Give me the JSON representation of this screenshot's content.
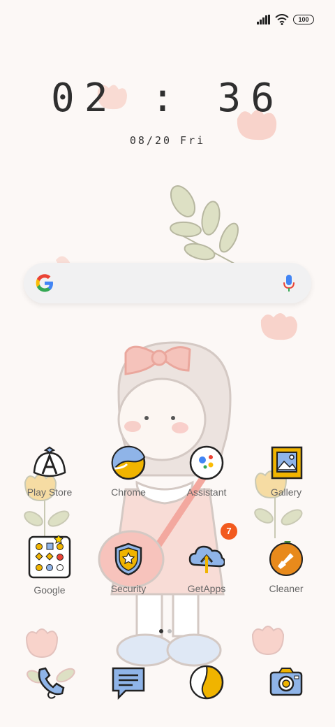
{
  "status_bar": {
    "battery": "100",
    "icons": [
      "signal-icon",
      "wifi-icon",
      "battery-icon"
    ]
  },
  "clock": {
    "time": "02 : 36",
    "date": "08/20 Fri"
  },
  "search": {
    "logo": "google-g-icon",
    "mic": "mic-icon"
  },
  "apps": {
    "row1": [
      {
        "label": "Play Store",
        "icon": "play-store-icon"
      },
      {
        "label": "Chrome",
        "icon": "chrome-icon"
      },
      {
        "label": "Assistant",
        "icon": "assistant-icon"
      },
      {
        "label": "Gallery",
        "icon": "gallery-icon"
      }
    ],
    "row2": [
      {
        "label": "Google",
        "icon": "google-folder-icon"
      },
      {
        "label": "Security",
        "icon": "security-icon"
      },
      {
        "label": "GetApps",
        "icon": "getapps-icon",
        "badge": "7"
      },
      {
        "label": "Cleaner",
        "icon": "cleaner-icon"
      }
    ]
  },
  "dock": [
    "phone-icon",
    "messages-icon",
    "browser-icon",
    "camera-icon"
  ],
  "page_indicator": {
    "count": 2,
    "active": 1
  },
  "colors": {
    "background": "#fcf8f6",
    "accent_yellow": "#f0b400",
    "badge": "#f25a1e",
    "pink": "#f6c9c2"
  }
}
